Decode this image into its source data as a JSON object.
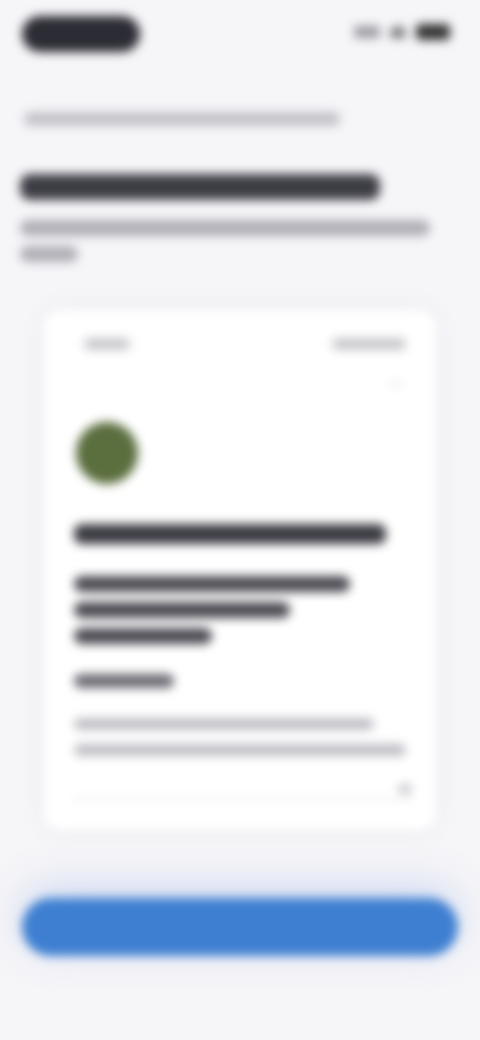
{
  "status_bar": {
    "time": "",
    "icons": [
      "signal-icon",
      "wifi-icon",
      "battery-icon"
    ]
  },
  "header": {
    "breadcrumb": "",
    "title": "",
    "subtitle": ""
  },
  "card": {
    "left_label": "",
    "right_label": "",
    "organization_name": "",
    "headline_lines": [
      "",
      "",
      ""
    ],
    "meta": "",
    "description_lines": [
      "",
      ""
    ],
    "icons": {
      "menu": "more-icon",
      "avatar": "organization-logo"
    }
  },
  "footer": {
    "primary_button": ""
  },
  "colors": {
    "accent": "#3f7fd1",
    "avatar": "#5b6e3e",
    "background": "#f6f5f8"
  }
}
